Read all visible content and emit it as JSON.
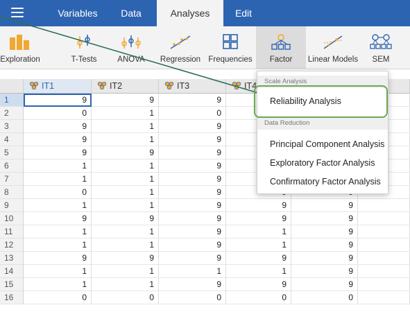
{
  "tabs": [
    {
      "label": "Variables",
      "active": false
    },
    {
      "label": "Data",
      "active": false
    },
    {
      "label": "Analyses",
      "active": true
    },
    {
      "label": "Edit",
      "active": false
    }
  ],
  "ribbon": [
    {
      "label": "Exploration",
      "icon": "exploration-icon"
    },
    {
      "label": "T-Tests",
      "icon": "ttests-icon"
    },
    {
      "label": "ANOVA",
      "icon": "anova-icon"
    },
    {
      "label": "Regression",
      "icon": "regression-icon"
    },
    {
      "label": "Frequencies",
      "icon": "frequencies-icon"
    },
    {
      "label": "Factor",
      "icon": "factor-icon",
      "selected": true
    },
    {
      "label": "Linear Models",
      "icon": "linear-models-icon"
    },
    {
      "label": "SEM",
      "icon": "sem-icon"
    }
  ],
  "columns": [
    "IT1",
    "IT2",
    "IT3",
    "IT4"
  ],
  "rows": [
    [
      "1",
      "9",
      "9",
      "9",
      "",
      ""
    ],
    [
      "2",
      "0",
      "1",
      "0",
      "",
      ""
    ],
    [
      "3",
      "9",
      "1",
      "9",
      "",
      ""
    ],
    [
      "4",
      "9",
      "1",
      "9",
      "",
      ""
    ],
    [
      "5",
      "9",
      "9",
      "9",
      "",
      ""
    ],
    [
      "6",
      "1",
      "1",
      "9",
      "",
      ""
    ],
    [
      "7",
      "1",
      "1",
      "9",
      "",
      ""
    ],
    [
      "8",
      "0",
      "1",
      "9",
      "9",
      "9"
    ],
    [
      "9",
      "1",
      "1",
      "9",
      "9",
      "9"
    ],
    [
      "10",
      "9",
      "9",
      "9",
      "9",
      "9"
    ],
    [
      "11",
      "1",
      "1",
      "9",
      "1",
      "9"
    ],
    [
      "12",
      "1",
      "1",
      "9",
      "1",
      "9"
    ],
    [
      "13",
      "9",
      "9",
      "9",
      "9",
      "9"
    ],
    [
      "14",
      "1",
      "1",
      "1",
      "1",
      "9"
    ],
    [
      "15",
      "1",
      "1",
      "9",
      "9",
      "9"
    ],
    [
      "16",
      "0",
      "0",
      "0",
      "0",
      "0"
    ]
  ],
  "menu": {
    "section1": "Scale Analysis",
    "item_reliability": "Reliability Analysis",
    "section2": "Data Reduction",
    "item_pca": "Principal Component Analysis",
    "item_efa": "Exploratory Factor Analysis",
    "item_cfa": "Confirmatory Factor Analysis"
  },
  "colors": {
    "accent": "#2d64b2",
    "highlight": "#6aa84f",
    "icon_orange": "#f0a830"
  }
}
